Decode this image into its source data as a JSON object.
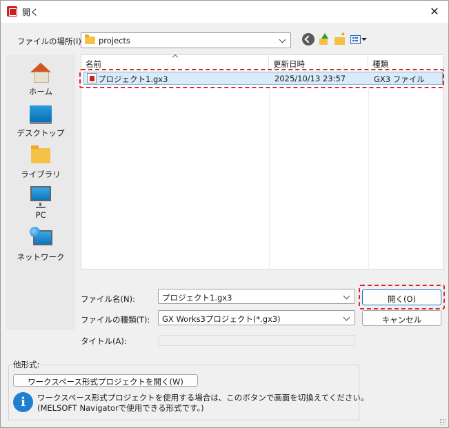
{
  "window": {
    "title": "開く"
  },
  "toolbar": {
    "look_in_label": "ファイルの場所(I):",
    "look_in_value": "projects"
  },
  "places": [
    {
      "label": "ホーム",
      "icon": "home-icon"
    },
    {
      "label": "デスクトップ",
      "icon": "desktop-icon"
    },
    {
      "label": "ライブラリ",
      "icon": "library-icon"
    },
    {
      "label": "PC",
      "icon": "pc-icon"
    },
    {
      "label": "ネットワーク",
      "icon": "network-icon"
    }
  ],
  "file_list": {
    "columns": [
      "名前",
      "更新日時",
      "種類"
    ],
    "rows": [
      {
        "name": "プロジェクト1.gx3",
        "modified": "2025/10/13 23:57",
        "type": "GX3 ファイル",
        "selected": true
      }
    ]
  },
  "form": {
    "filename_label": "ファイル名(N):",
    "filename_value": "プロジェクト1.gx3",
    "filetype_label": "ファイルの種類(T):",
    "filetype_value": "GX Works3プロジェクト(*.gx3)",
    "title_label": "タイトル(A):",
    "title_value": "",
    "open_button": "開く(O)",
    "cancel_button": "キャンセル"
  },
  "other_format": {
    "group_label": "他形式:",
    "workspace_button": "ワークスペース形式プロジェクトを開く(W)",
    "info_line1": "ワークスペース形式プロジェクトを使用する場合は、このボタンで画面を切換えてください。",
    "info_line2": "(MELSOFT Navigatorで使用できる形式です。)"
  },
  "colors": {
    "selection_fill": "#d9ebf9",
    "highlight_dash": "#d8262b",
    "accent": "#1e78d4"
  }
}
